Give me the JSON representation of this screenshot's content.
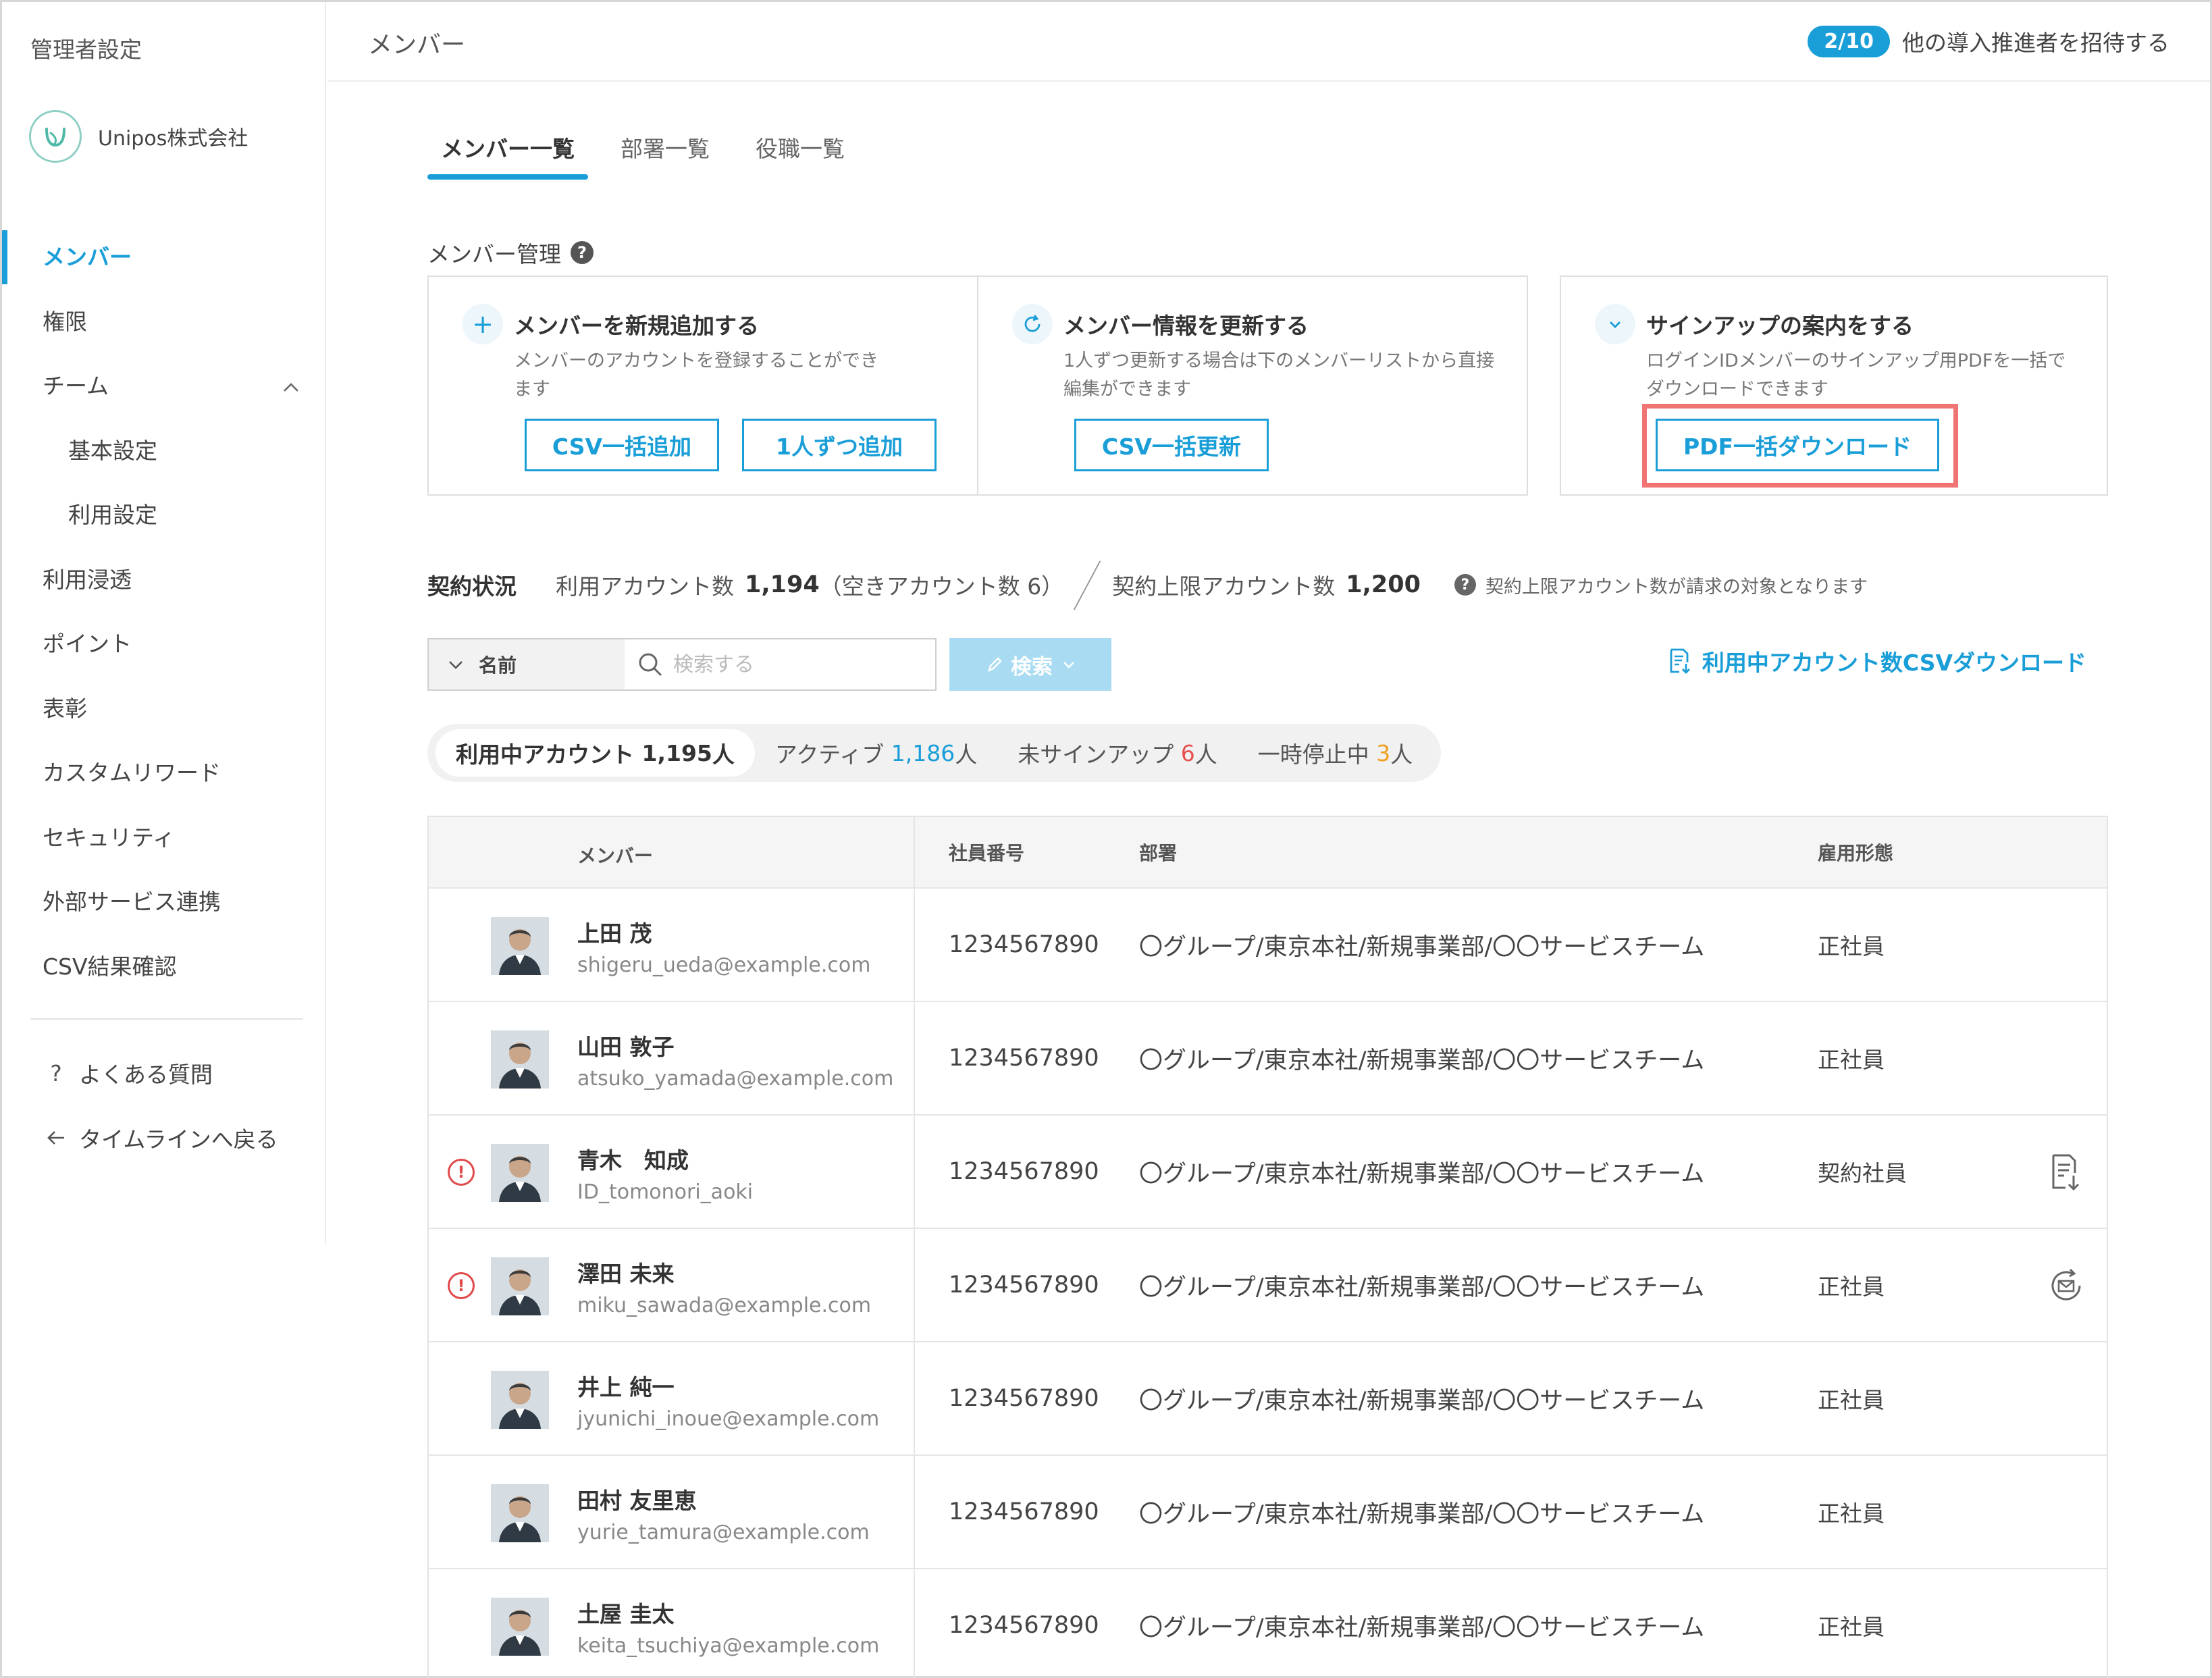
{
  "sidebar": {
    "title": "管理者設定",
    "org_name": "Unipos株式会社",
    "items": [
      {
        "label": "メンバー",
        "active": true
      },
      {
        "label": "権限"
      },
      {
        "label": "チーム",
        "expanded": true
      },
      {
        "label": "基本設定",
        "sub": true
      },
      {
        "label": "利用設定",
        "sub": true
      },
      {
        "label": "利用浸透"
      },
      {
        "label": "ポイント"
      },
      {
        "label": "表彰"
      },
      {
        "label": "カスタムリワード"
      },
      {
        "label": "セキュリティ"
      },
      {
        "label": "外部サービス連携"
      },
      {
        "label": "CSV結果確認"
      }
    ],
    "faq_label": "よくある質問",
    "back_label": "タイムラインへ戻る"
  },
  "header": {
    "title": "メンバー",
    "invite_badge": "2/10",
    "invite_text": "他の導入推進者を招待する"
  },
  "tabs": [
    {
      "label": "メンバー一覧",
      "active": true
    },
    {
      "label": "部署一覧"
    },
    {
      "label": "役職一覧"
    }
  ],
  "management": {
    "title": "メンバー管理",
    "cards": [
      {
        "icon": "plus-icon",
        "title": "メンバーを新規追加する",
        "desc": "メンバーのアカウントを登録することができます",
        "buttons": [
          "CSV一括追加",
          "1人ずつ追加"
        ]
      },
      {
        "icon": "refresh-icon",
        "title": "メンバー情報を更新する",
        "desc": "1人ずつ更新する場合は下のメンバーリストから直接編集ができます",
        "buttons": [
          "CSV一括更新"
        ]
      },
      {
        "icon": "check-icon",
        "title": "サインアップの案内をする",
        "desc": "ログインIDメンバーのサインアップ用PDFを一括でダウンロードできます",
        "buttons": [
          "PDF一括ダウンロード"
        ]
      }
    ],
    "highlight_color": "#f07474"
  },
  "contract": {
    "label": "契約状況",
    "used_label": "利用アカウント数",
    "used_value": "1,194",
    "free_text": "（空きアカウント数 6）",
    "limit_label": "契約上限アカウント数",
    "limit_value": "1,200",
    "note": "契約上限アカウント数が請求の対象となります"
  },
  "search": {
    "select_value": "名前",
    "placeholder": "検索する",
    "button_label": "検索",
    "csv_download_label": "利用中アカウント数CSVダウンロード"
  },
  "filters": [
    {
      "label": "利用中アカウント",
      "count": "1,195",
      "unit": "人",
      "active": true
    },
    {
      "label": "アクティブ",
      "count": "1,186",
      "unit": "人",
      "color": "#1a9ed8"
    },
    {
      "label": "未サインアップ",
      "count": "6",
      "unit": "人",
      "color": "#e85050"
    },
    {
      "label": "一時停止中",
      "count": "3",
      "unit": "人",
      "color": "#f0a020"
    }
  ],
  "table": {
    "headers": {
      "member": "メンバー",
      "emp_no": "社員番号",
      "dept": "部署",
      "type": "雇用形態"
    },
    "rows": [
      {
        "name": "上田 茂",
        "email": "shigeru_ueda@example.com",
        "emp_no": "1234567890",
        "dept": "〇グループ/東京本社/新規事業部/〇〇サービスチーム",
        "type": "正社員",
        "warn": false,
        "action": ""
      },
      {
        "name": "山田 敦子",
        "email": "atsuko_yamada@example.com",
        "emp_no": "1234567890",
        "dept": "〇グループ/東京本社/新規事業部/〇〇サービスチーム",
        "type": "正社員",
        "warn": false,
        "action": ""
      },
      {
        "name": "青木　知成",
        "email": "ID_tomonori_aoki",
        "emp_no": "1234567890",
        "dept": "〇グループ/東京本社/新規事業部/〇〇サービスチーム",
        "type": "契約社員",
        "warn": true,
        "action": "pdf-download-icon"
      },
      {
        "name": "澤田 未来",
        "email": "miku_sawada@example.com",
        "emp_no": "1234567890",
        "dept": "〇グループ/東京本社/新規事業部/〇〇サービスチーム",
        "type": "正社員",
        "warn": true,
        "action": "resend-mail-icon"
      },
      {
        "name": "井上 純一",
        "email": "jyunichi_inoue@example.com",
        "emp_no": "1234567890",
        "dept": "〇グループ/東京本社/新規事業部/〇〇サービスチーム",
        "type": "正社員",
        "warn": false,
        "action": ""
      },
      {
        "name": "田村 友里恵",
        "email": "yurie_tamura@example.com",
        "emp_no": "1234567890",
        "dept": "〇グループ/東京本社/新規事業部/〇〇サービスチーム",
        "type": "正社員",
        "warn": false,
        "action": ""
      },
      {
        "name": "土屋 圭太",
        "email": "keita_tsuchiya@example.com",
        "emp_no": "1234567890",
        "dept": "〇グループ/東京本社/新規事業部/〇〇サービスチーム",
        "type": "正社員",
        "warn": false,
        "action": ""
      }
    ]
  },
  "colors": {
    "accent": "#1a9ed8",
    "warning": "#e04a4a"
  }
}
